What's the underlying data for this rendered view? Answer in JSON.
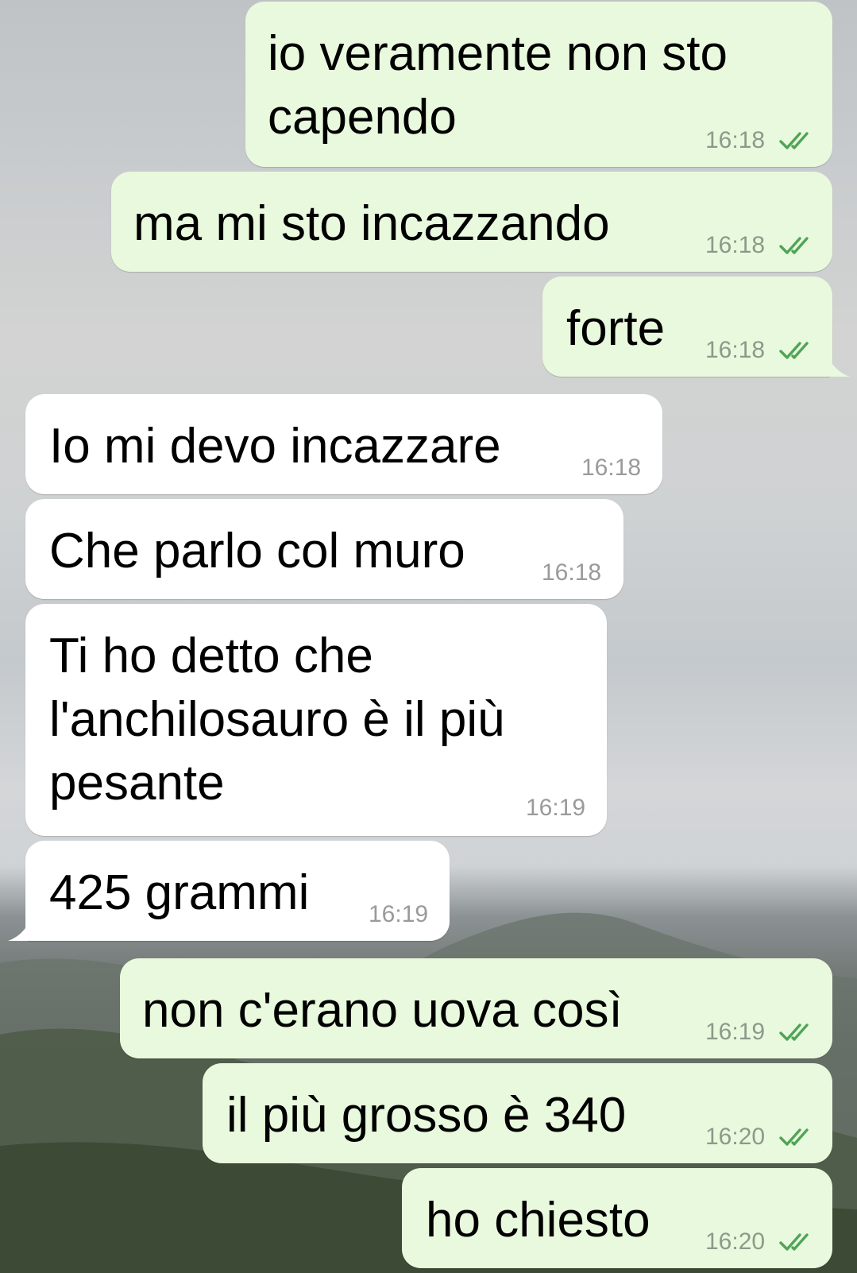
{
  "chat": {
    "messages": [
      {
        "lines": [
          "io veramente non sto",
          "capendo"
        ],
        "time": "16:18",
        "outgoing": true
      },
      {
        "lines": [
          "ma mi sto incazzando"
        ],
        "time": "16:18",
        "outgoing": true
      },
      {
        "lines": [
          "forte"
        ],
        "time": "16:18",
        "outgoing": true
      },
      {
        "lines": [
          "Io mi devo incazzare"
        ],
        "time": "16:18",
        "outgoing": false
      },
      {
        "lines": [
          "Che parlo col muro"
        ],
        "time": "16:18",
        "outgoing": false
      },
      {
        "lines": [
          "Ti ho detto che",
          "l'anchilosauro è il più",
          "pesante"
        ],
        "time": "16:19",
        "outgoing": false
      },
      {
        "lines": [
          "425 grammi"
        ],
        "time": "16:19",
        "outgoing": false
      },
      {
        "lines": [
          "non c'erano uova così"
        ],
        "time": "16:19",
        "outgoing": true
      },
      {
        "lines": [
          "il più grosso è 340"
        ],
        "time": "16:20",
        "outgoing": true
      },
      {
        "lines": [
          "ho chiesto"
        ],
        "time": "16:20",
        "outgoing": true
      }
    ]
  },
  "colors": {
    "outgoing_bubble": "#e9f9dd",
    "incoming_bubble": "#ffffff",
    "read_check": "#4fa457"
  },
  "icons": {
    "read_receipt": "double-check-icon"
  }
}
